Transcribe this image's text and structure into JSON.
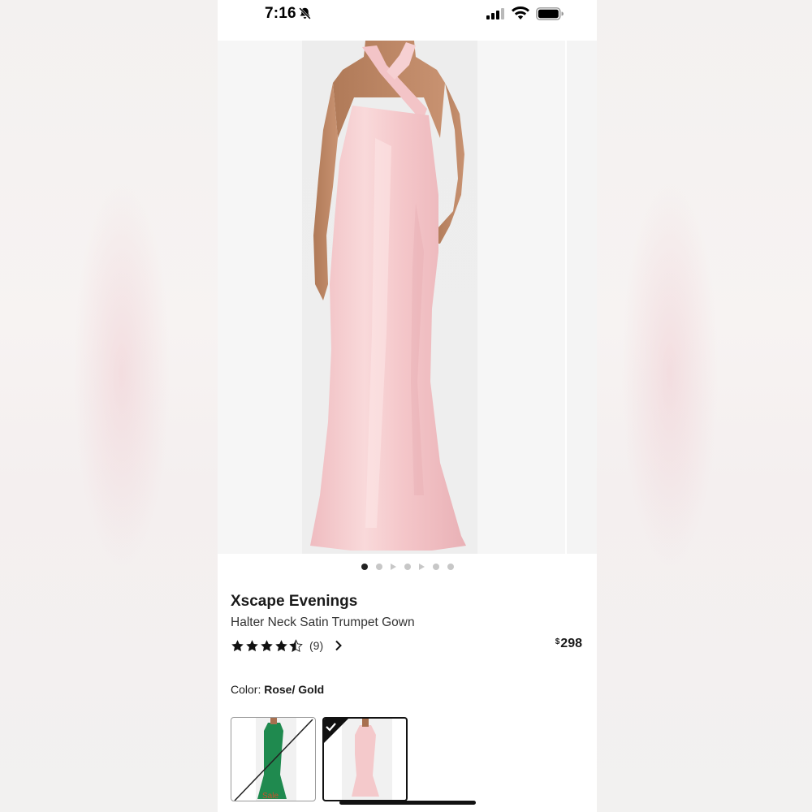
{
  "status_bar": {
    "time": "7:16",
    "icons": [
      "bell-slash-icon",
      "cellular-signal-icon",
      "wifi-icon",
      "battery-icon"
    ]
  },
  "gallery": {
    "image": "pink-halter-gown-photo",
    "dots": [
      "active",
      "dot",
      "play",
      "dot",
      "play",
      "dot",
      "dot"
    ]
  },
  "product": {
    "brand": "Xscape Evenings",
    "name": "Halter Neck Satin Trumpet Gown",
    "rating": 4.5,
    "review_count": "(9)",
    "price_currency": "$",
    "price_amount": "298"
  },
  "color": {
    "label": "Color: ",
    "value": "Rose/ Gold"
  },
  "swatches": [
    {
      "color": "green",
      "unavailable": true,
      "tag": "Sale"
    },
    {
      "color": "rose",
      "selected": true
    }
  ],
  "colors": {
    "gown_pink": "#f4c9cb",
    "swatch_green": "#1f8a4f",
    "sale_text": "#c8522d"
  }
}
